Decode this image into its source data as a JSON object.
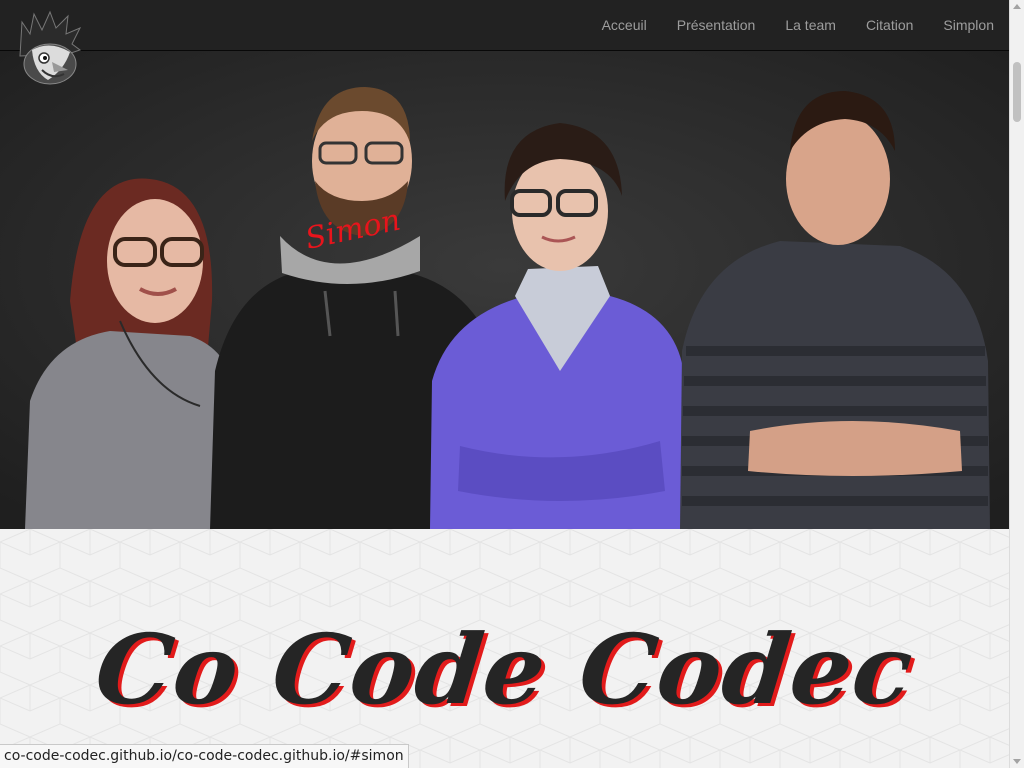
{
  "navbar": {
    "logo_icon": "rooster-logo-icon",
    "links": [
      "Acceuil",
      "Présentation",
      "La team",
      "Citation",
      "Simplon"
    ]
  },
  "hero": {
    "photo_label": "Simon",
    "label_color": "#e8141c"
  },
  "main": {
    "title": "Co Code Codec",
    "title_shadow_color": "#e21b1b"
  },
  "statusbar": {
    "url": "co-code-codec.github.io/co-code-codec.github.io/#simon"
  }
}
